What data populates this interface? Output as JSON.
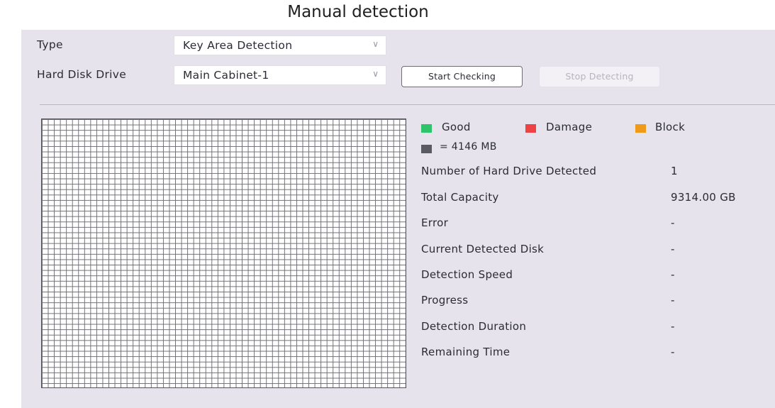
{
  "title": "Manual detection",
  "form": {
    "type_label": "Type",
    "type_value": "Key Area Detection",
    "hdd_label": "Hard Disk Drive",
    "hdd_value": "Main Cabinet-1",
    "start_label": "Start Checking",
    "stop_label": "Stop Detecting"
  },
  "legend": {
    "good": "Good",
    "damage": "Damage",
    "block": "Block",
    "unit": "= 4146 MB",
    "colors": {
      "good": "#2fc46b",
      "damage": "#ef4245",
      "block": "#f09a1a",
      "unit": "#5b5a63"
    }
  },
  "stats": [
    {
      "label": "Number of Hard Drive Detected",
      "value": "1"
    },
    {
      "label": "Total Capacity",
      "value": "9314.00 GB"
    },
    {
      "label": "Error",
      "value": "-"
    },
    {
      "label": "Current Detected Disk",
      "value": "-"
    },
    {
      "label": "Detection Speed",
      "value": "-"
    },
    {
      "label": "Progress",
      "value": "-"
    },
    {
      "label": "Detection Duration",
      "value": "-"
    },
    {
      "label": "Remaining Time",
      "value": "-"
    }
  ],
  "icons": {
    "chevron": "chevron-down-icon"
  }
}
